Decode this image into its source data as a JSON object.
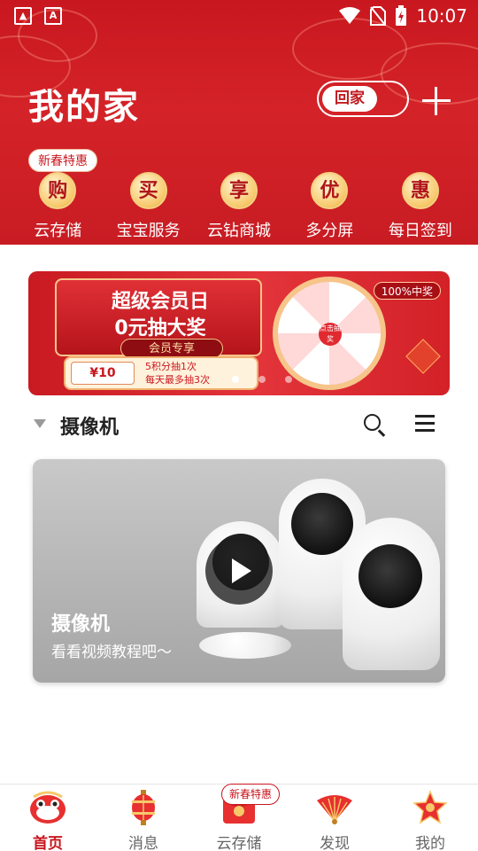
{
  "status_bar": {
    "time": "10:07",
    "left_icons": [
      "image-icon",
      "app-a-icon"
    ],
    "right_icons": [
      "wifi-icon",
      "no-sim-icon",
      "battery-charging-icon"
    ]
  },
  "header": {
    "title": "我的家",
    "toggle_label": "回家",
    "add_icon": "plus-icon"
  },
  "services": {
    "promo_tag": "新春特惠",
    "items": [
      {
        "glyph": "购",
        "label": "云存储"
      },
      {
        "glyph": "买",
        "label": "宝宝服务"
      },
      {
        "glyph": "享",
        "label": "云钻商城"
      },
      {
        "glyph": "优",
        "label": "多分屏"
      },
      {
        "glyph": "惠",
        "label": "每日签到"
      }
    ]
  },
  "banner": {
    "line1": "超级会员日",
    "line2": "0元抽大奖",
    "vip": "会员专享",
    "coupon_value": "¥10",
    "coupon_text_1": "5积分抽1次",
    "coupon_text_2": "每天最多抽3次",
    "badge": "100%中奖",
    "wheel_center": "点击抽奖",
    "page_count": 3,
    "active_page": 1
  },
  "camera_section": {
    "title": "摄像机",
    "card_title": "摄像机",
    "card_subtitle": "看看视频教程吧〜"
  },
  "bottom_nav": {
    "promo_tag": "新春特惠",
    "items": [
      {
        "label": "首页",
        "icon": "lion-dance-icon",
        "active": true
      },
      {
        "label": "消息",
        "icon": "lantern-icon",
        "active": false
      },
      {
        "label": "云存储",
        "icon": "red-envelope-icon",
        "active": false
      },
      {
        "label": "发现",
        "icon": "fan-icon",
        "active": false
      },
      {
        "label": "我的",
        "icon": "firecracker-star-icon",
        "active": false
      }
    ]
  },
  "colors": {
    "primary_red": "#c9171f",
    "text_dark": "#222222",
    "nav_inactive": "#666666"
  }
}
